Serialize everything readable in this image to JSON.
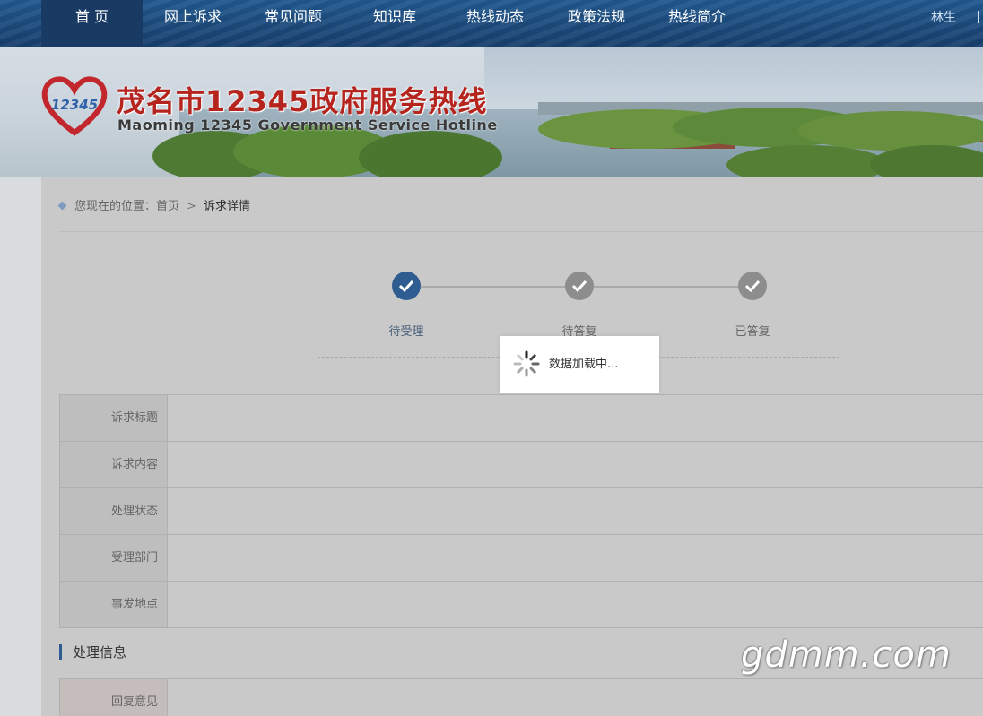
{
  "nav": {
    "items": [
      {
        "label": "首 页",
        "active": true
      },
      {
        "label": "网上诉求"
      },
      {
        "label": "常见问题"
      },
      {
        "label": "知识库"
      },
      {
        "label": "热线动态"
      },
      {
        "label": "政策法规"
      },
      {
        "label": "热线简介"
      }
    ],
    "user": "林生"
  },
  "banner": {
    "logo_icon": "heart-12345-logo",
    "logo_number": "12345",
    "title_cn": "茂名市12345政府服务热线",
    "title_en": "Maoming 12345 Government Service Hotline"
  },
  "breadcrumb": {
    "prefix": "您现在的位置：",
    "home": "首页",
    "separator": ">",
    "current": "诉求详情"
  },
  "steps": [
    {
      "label": "待受理",
      "done": true
    },
    {
      "label": "待答复",
      "done": false
    },
    {
      "label": "已答复",
      "done": false
    }
  ],
  "info_fields": [
    {
      "label": "诉求标题",
      "value": ""
    },
    {
      "label": "诉求内容",
      "value": ""
    },
    {
      "label": "处理状态",
      "value": ""
    },
    {
      "label": "受理部门",
      "value": ""
    },
    {
      "label": "事发地点",
      "value": ""
    }
  ],
  "section": {
    "title": "处理信息"
  },
  "reply": {
    "label": "回复意见",
    "value": ""
  },
  "loading": {
    "text": "数据加载中...",
    "icon": "spinner-icon"
  },
  "watermark": "gdmm.com",
  "colors": {
    "nav_bg": "#1d4f86",
    "nav_active": "#183a63",
    "step_done": "#2f5c91",
    "step_pending": "#8d8d8d",
    "logo_red": "#b6241e"
  }
}
